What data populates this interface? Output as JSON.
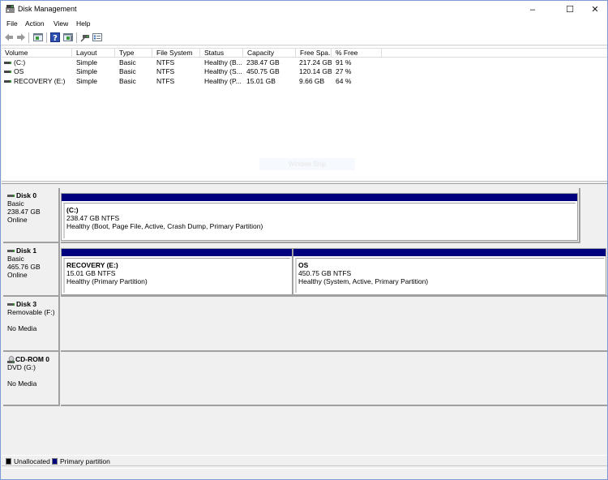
{
  "window": {
    "title": "Disk Management",
    "controls": {
      "minimize": "–",
      "maximize": "☐",
      "close": "✕"
    }
  },
  "menu": [
    "File",
    "Action",
    "View",
    "Help"
  ],
  "toolbar": [
    {
      "icon": "back-arrow-icon"
    },
    {
      "icon": "forward-arrow-icon"
    },
    {
      "icon": "show-hide-console-tree-icon"
    },
    {
      "icon": "help-icon"
    },
    {
      "icon": "show-action-pane-icon"
    },
    {
      "icon": "connect-disk-icon"
    },
    {
      "icon": "properties-list-icon"
    }
  ],
  "volume_list": {
    "columns": [
      "Volume",
      "Layout",
      "Type",
      "File System",
      "Status",
      "Capacity",
      "Free Spa...",
      "% Free"
    ],
    "rows": [
      {
        "volume": "(C:)",
        "layout": "Simple",
        "type": "Basic",
        "fs": "NTFS",
        "status": "Healthy (B...",
        "capacity": "238.47 GB",
        "free": "217.24 GB",
        "pct": "91 %"
      },
      {
        "volume": "OS",
        "layout": "Simple",
        "type": "Basic",
        "fs": "NTFS",
        "status": "Healthy (S...",
        "capacity": "450.75 GB",
        "free": "120.14 GB",
        "pct": "27 %"
      },
      {
        "volume": "RECOVERY (E:)",
        "layout": "Simple",
        "type": "Basic",
        "fs": "NTFS",
        "status": "Healthy (P...",
        "capacity": "15.01 GB",
        "free": "9.66 GB",
        "pct": "64 %"
      }
    ]
  },
  "watermark": "Window Snip",
  "disks": [
    {
      "name": "Disk 0",
      "type": "Basic",
      "size": "238.47 GB",
      "state": "Online",
      "partitions": [
        {
          "name": "(C:)",
          "size": "238.47 GB NTFS",
          "status": "Healthy (Boot, Page File, Active, Crash Dump, Primary Partition)"
        }
      ]
    },
    {
      "name": "Disk 1",
      "type": "Basic",
      "size": "465.76 GB",
      "state": "Online",
      "partitions": [
        {
          "name": "RECOVERY  (E:)",
          "size": "15.01 GB NTFS",
          "status": "Healthy (Primary Partition)"
        },
        {
          "name": "OS",
          "size": "450.75 GB NTFS",
          "status": "Healthy (System, Active, Primary Partition)"
        }
      ]
    },
    {
      "name": "Disk 3",
      "type": "Removable (F:)",
      "state": "No Media",
      "partitions": []
    },
    {
      "name": "CD-ROM 0",
      "type": "DVD (G:)",
      "state": "No Media",
      "partitions": []
    }
  ],
  "legend": [
    {
      "label": "Unallocated",
      "color": "#000000"
    },
    {
      "label": "Primary partition",
      "color": "#00007f"
    }
  ]
}
